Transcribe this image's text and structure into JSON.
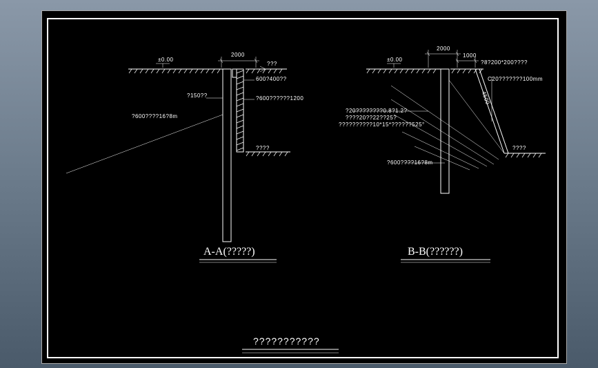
{
  "section_a": {
    "datum": "±0.00",
    "dim_2000": "2000",
    "grade_label": "???",
    "pile_label": "?150??",
    "pile_spec": "?600????16?8m",
    "box_600x400": "600?400??",
    "box_600wide": "?600??????1200",
    "bottom_label": "????",
    "title": "A-A(?????)"
  },
  "section_b": {
    "datum": "±0.00",
    "dim_2000": "2000",
    "dim_1000": "1000",
    "anchor_spec": "?8?200*200????",
    "concrete_spec": "C20???????100mm",
    "note1": "?20????????0.8?1.2?",
    "note2": "????20??22??25?",
    "note3": "??????????10*15*??????525°",
    "bottom_label": "????",
    "pile_spec": "?600????16?8m",
    "vert_label": "4500",
    "title": "B-B(??????)"
  },
  "drawing_title": "???????????"
}
